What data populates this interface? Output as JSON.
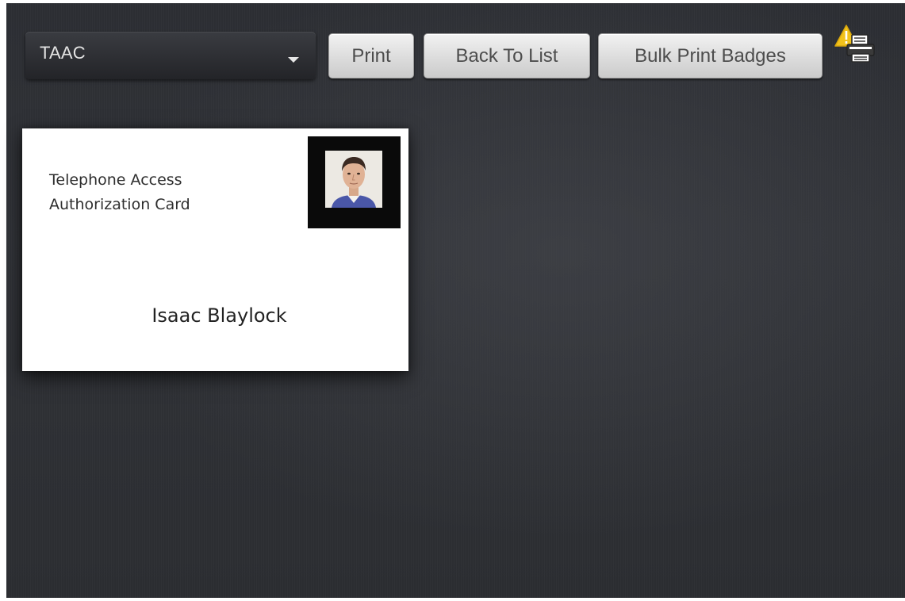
{
  "toolbar": {
    "dropdown_value": "TAAC",
    "print_label": "Print",
    "back_label": "Back To List",
    "bulk_label": "Bulk Print Badges",
    "printer_icon": "printer-warning-icon"
  },
  "badge": {
    "title_line1": "Telephone Access",
    "title_line2": "Authorization Card",
    "name": "Isaac Blaylock"
  },
  "colors": {
    "background": "#2e3035",
    "button_text": "#4d4d4d",
    "warning": "#f2c21b"
  }
}
